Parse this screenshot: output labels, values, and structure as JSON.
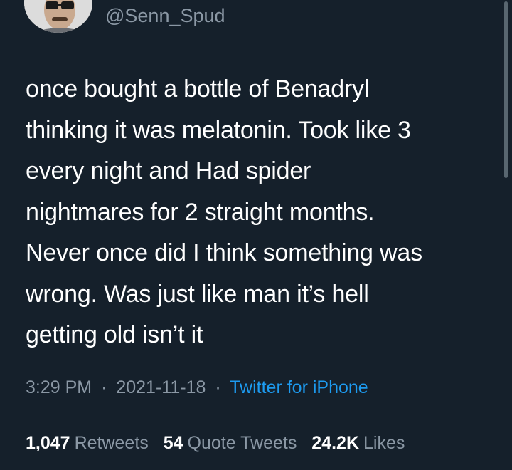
{
  "tweet": {
    "handle": "@Senn_Spud",
    "avatar_icon": "user-avatar-sunglasses",
    "text_lines": [
      "once bought a bottle of Benadryl",
      "thinking it was melatonin. Took like 3",
      "every night and Had spider",
      "nightmares for 2 straight months.",
      "Never once did I think something was",
      "wrong. Was just like man it’s hell",
      "getting old isn’t it"
    ],
    "time": "3:29 PM",
    "separator": "·",
    "date": "2021-11-18",
    "source": "Twitter for iPhone"
  },
  "stats": {
    "retweets_count": "1,047",
    "retweets_label": "Retweets",
    "quotes_count": "54",
    "quotes_label": "Quote Tweets",
    "likes_count": "24.2K",
    "likes_label": "Likes"
  },
  "colors": {
    "background": "#15202b",
    "text": "#ffffff",
    "secondary": "#8b98a5",
    "link": "#1d9bf0",
    "divider": "#38444d"
  }
}
